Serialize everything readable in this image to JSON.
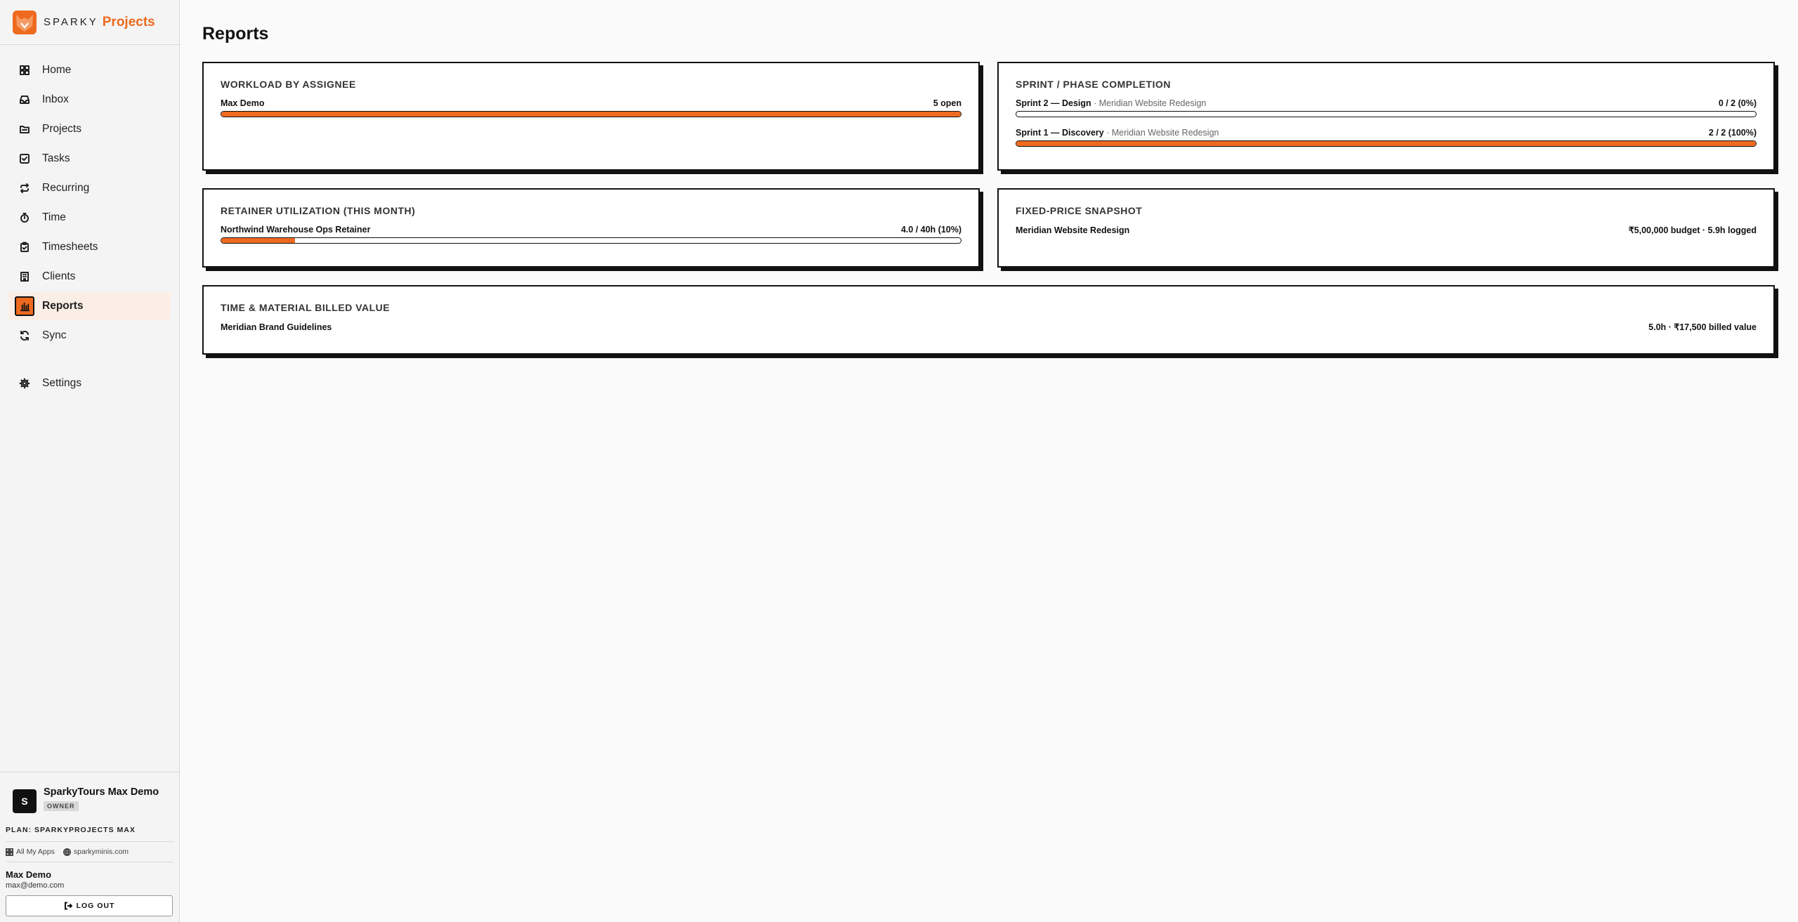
{
  "brand": {
    "word": "SPARKY",
    "app": "Projects"
  },
  "colors": {
    "accent": "#ee6a1f",
    "ink": "#111111"
  },
  "nav": {
    "items": [
      {
        "label": "Home",
        "icon": "home-grid-icon"
      },
      {
        "label": "Inbox",
        "icon": "inbox-icon"
      },
      {
        "label": "Projects",
        "icon": "folder-icon"
      },
      {
        "label": "Tasks",
        "icon": "check-square-icon"
      },
      {
        "label": "Recurring",
        "icon": "repeat-icon"
      },
      {
        "label": "Time",
        "icon": "stopwatch-icon"
      },
      {
        "label": "Timesheets",
        "icon": "clipboard-icon"
      },
      {
        "label": "Clients",
        "icon": "building-icon"
      },
      {
        "label": "Reports",
        "icon": "bar-chart-icon",
        "active": true
      },
      {
        "label": "Sync",
        "icon": "sync-icon"
      }
    ],
    "settings": {
      "label": "Settings",
      "icon": "gear-icon"
    }
  },
  "org": {
    "avatar": "S",
    "name": "SparkyTours Max Demo",
    "role": "OWNER",
    "plan": "PLAN: SPARKYPROJECTS MAX"
  },
  "links": {
    "all_apps": "All My Apps",
    "site": "sparkyminis.com"
  },
  "user": {
    "name": "Max Demo",
    "email": "max@demo.com",
    "logout": "LOG OUT"
  },
  "page": {
    "title": "Reports"
  },
  "workload": {
    "title": "WORKLOAD BY ASSIGNEE",
    "rows": [
      {
        "label": "Max Demo",
        "value": "5 open",
        "progress": 1.0
      }
    ]
  },
  "sprint": {
    "title": "SPRINT / PHASE COMPLETION",
    "rows": [
      {
        "label": "Sprint 2 — Design",
        "sub": " · Meridian Website Redesign",
        "value": "0 / 2 (0%)",
        "progress": 0.0
      },
      {
        "label": "Sprint 1 — Discovery",
        "sub": " · Meridian Website Redesign",
        "value": "2 / 2 (100%)",
        "progress": 1.0
      }
    ]
  },
  "retainer": {
    "title": "RETAINER UTILIZATION (THIS MONTH)",
    "rows": [
      {
        "label": "Northwind Warehouse Ops Retainer",
        "value": "4.0 / 40h (10%)",
        "progress": 0.1
      }
    ]
  },
  "fixed": {
    "title": "FIXED-PRICE SNAPSHOT",
    "rows": [
      {
        "label": "Meridian Website Redesign",
        "value": "₹5,00,000 budget · 5.9h logged"
      }
    ]
  },
  "tm": {
    "title": "TIME & MATERIAL BILLED VALUE",
    "rows": [
      {
        "label": "Meridian Brand Guidelines",
        "value": "5.0h · ₹17,500 billed value"
      }
    ]
  }
}
